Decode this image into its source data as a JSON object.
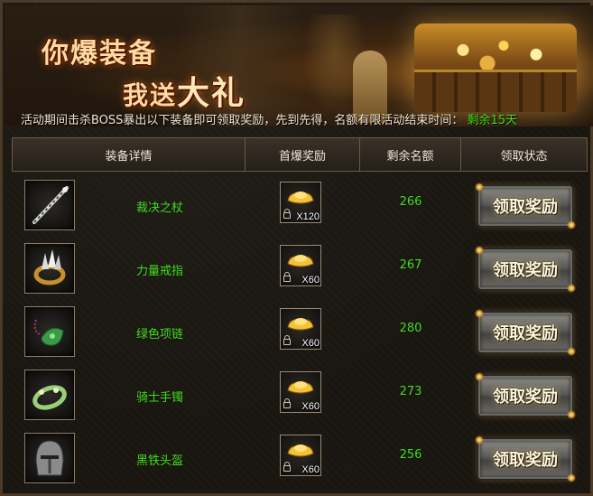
{
  "banner": {
    "title_line1": "你爆装备",
    "title_line2_a": "我送",
    "title_line2_b": "大礼",
    "notice": "活动期间击杀BOSS暴出以下装备即可领取奖励，先到先得，名额有限活动结束时间：",
    "remaining": "剩余15天"
  },
  "table": {
    "headers": [
      "装备详情",
      "首爆奖励",
      "剩余名额",
      "领取状态"
    ],
    "rows": [
      {
        "name": "裁决之杖",
        "icon": "staff-icon",
        "reward_qty": "X120",
        "remaining": "266",
        "button": "领取奖励"
      },
      {
        "name": "力量戒指",
        "icon": "ring-icon",
        "reward_qty": "X60",
        "remaining": "267",
        "button": "领取奖励"
      },
      {
        "name": "绿色项链",
        "icon": "necklace-icon",
        "reward_qty": "X60",
        "remaining": "280",
        "button": "领取奖励"
      },
      {
        "name": "骑士手镯",
        "icon": "bracelet-icon",
        "reward_qty": "X60",
        "remaining": "273",
        "button": "领取奖励"
      },
      {
        "name": "黑铁头盔",
        "icon": "helmet-icon",
        "reward_qty": "X60",
        "remaining": "256",
        "button": "领取奖励"
      }
    ]
  },
  "colors": {
    "accent_green": "#3fdc1f",
    "ingot_gold": "#f2c23a"
  }
}
